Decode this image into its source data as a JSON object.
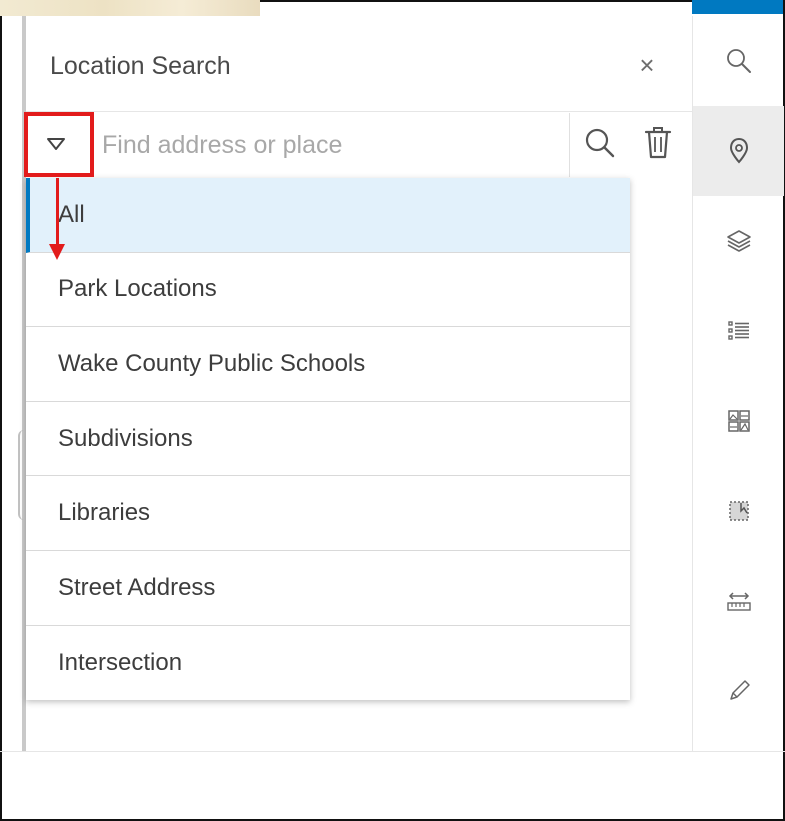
{
  "panel": {
    "title": "Location Search",
    "close_label": "×"
  },
  "search": {
    "placeholder": "Find address or place",
    "value": ""
  },
  "sources_menu": {
    "selected": "All",
    "items": [
      "All",
      "Park Locations",
      "Wake County Public Schools",
      "Subdivisions",
      "Libraries",
      "Street Address",
      "Intersection"
    ]
  },
  "toolbar": {
    "tools": [
      {
        "icon": "search-icon",
        "active": false
      },
      {
        "icon": "location-pin-icon",
        "active": true
      },
      {
        "icon": "layers-icon",
        "active": false
      },
      {
        "icon": "legend-list-icon",
        "active": false
      },
      {
        "icon": "basemap-gallery-icon",
        "active": false
      },
      {
        "icon": "select-tool-icon",
        "active": false
      },
      {
        "icon": "measure-ruler-icon",
        "active": false
      },
      {
        "icon": "draw-pencil-icon",
        "active": false
      }
    ]
  },
  "colors": {
    "accent": "#0079c1",
    "annotation_red": "#e21b1b",
    "selected_bg": "#e2f1fb"
  }
}
